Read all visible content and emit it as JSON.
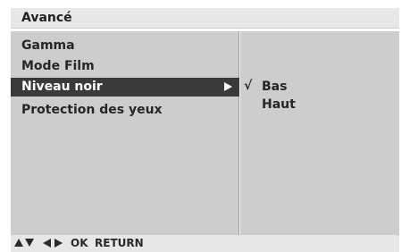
{
  "header": {
    "title": "Avancé"
  },
  "menu": {
    "items": [
      {
        "label": "Gamma",
        "selected": false
      },
      {
        "label": "Mode Film",
        "selected": false
      },
      {
        "label": "Niveau noir",
        "selected": true
      },
      {
        "label": "Protection des yeux",
        "selected": false
      }
    ]
  },
  "submenu": {
    "check_mark": "√",
    "options": [
      {
        "label": "Bas",
        "checked": true
      },
      {
        "label": "Haut",
        "checked": false
      }
    ]
  },
  "footer": {
    "icons": [
      "up-arrow-icon",
      "down-arrow-icon",
      "left-arrow-icon",
      "right-arrow-icon"
    ],
    "ok_label": "OK",
    "return_label": "RETURN"
  },
  "colors": {
    "panel": "#cdcdcd",
    "selected_bg": "#3a3a3a",
    "bar_bg": "#e7e7e7"
  }
}
